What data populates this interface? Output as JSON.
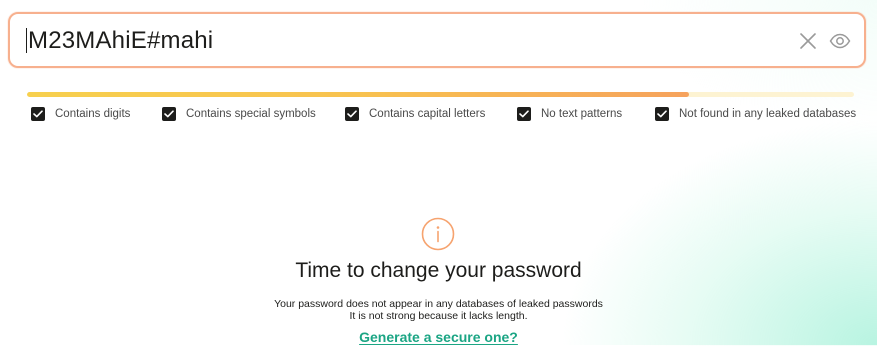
{
  "password_field": {
    "value": "M23MAhiE#mahi",
    "clear_icon": "close-icon",
    "visibility_icon": "eye-icon"
  },
  "strength": {
    "level": 0.8,
    "fill_colors": [
      "#f7d04e",
      "#f6a25c"
    ],
    "track_color": "#fdf3d2"
  },
  "checks": [
    {
      "label": "Contains digits",
      "checked": true
    },
    {
      "label": "Contains special symbols",
      "checked": true
    },
    {
      "label": "Contains capital letters",
      "checked": true
    },
    {
      "label": "No text patterns",
      "checked": true
    },
    {
      "label": "Not found in any leaked databases",
      "checked": true
    }
  ],
  "result": {
    "icon": "info-icon",
    "icon_color": "#f6a36f",
    "title": "Time to change your password",
    "description_lines": [
      "Your password does not appear in any databases of leaked passwords",
      "It is not strong because it lacks length."
    ],
    "link_label": "Generate a secure one?",
    "link_color": "#1ba584"
  },
  "colors": {
    "field_border": "#f7b08e",
    "check_fill": "#1d1d1b",
    "background_accent": "#a0f0d7"
  }
}
